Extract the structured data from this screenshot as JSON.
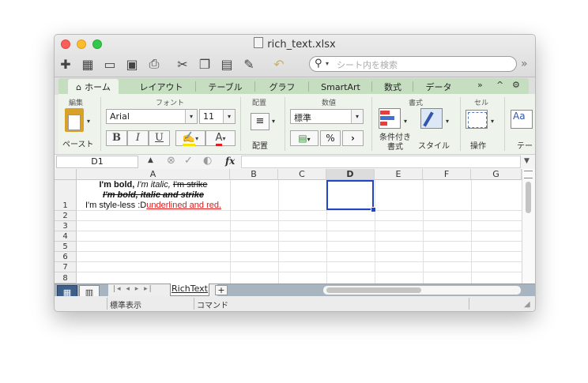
{
  "window": {
    "title": "rich_text.xlsx"
  },
  "toolbar": {
    "search_placeholder": "シート内を検索",
    "more_glyph": "»"
  },
  "ribbon_tabs": [
    "ホーム",
    "レイアウト",
    "テーブル",
    "グラフ",
    "SmartArt",
    "数式",
    "データ"
  ],
  "ribbon_tab_extras": {
    "more": "»",
    "collapse": "^",
    "settings": "⚙"
  },
  "ribbon": {
    "groups": {
      "edit": "編集",
      "font": "フォント",
      "align": "配置",
      "number": "数値",
      "format": "書式",
      "cells": "セル"
    },
    "paste_label": "ペースト",
    "font_name": "Arial",
    "font_size": "11",
    "bold": "B",
    "italic": "I",
    "underline": "U",
    "font_color_letter": "A",
    "align_label": "配置",
    "number_format": "標準",
    "percent": "%",
    "comma": "›",
    "cond_format_label1": "条件付き",
    "cond_format_label2": "書式",
    "style_label": "スタイル",
    "ops_label": "操作",
    "theme_label": "テー",
    "theme_icon_text": "Aa"
  },
  "formula_bar": {
    "name_box": "D1",
    "fx": "fx",
    "value": ""
  },
  "grid": {
    "columns": [
      "A",
      "B",
      "C",
      "D",
      "E",
      "F",
      "G"
    ],
    "selected_column": "D",
    "rows": [
      "1",
      "2",
      "3",
      "4",
      "5",
      "6",
      "7",
      "8"
    ],
    "cell_A1": {
      "line1_bold": "I'm bold,",
      "line1_italic": "I'm italic,",
      "line1_strike": "I'm strike",
      "line2": "I'm bold, italic and strike",
      "line3_plain": "I'm style-less :D",
      "line3_underlined": "underlined and red."
    }
  },
  "sheets": {
    "tabs": [
      "RichText"
    ],
    "add": "+"
  },
  "status": {
    "view": "標準表示",
    "mode": "コマンド"
  },
  "colors": {
    "accent_green": "#c5dec0",
    "selection_blue": "#2244c8",
    "red_text": "#e01b1b"
  }
}
